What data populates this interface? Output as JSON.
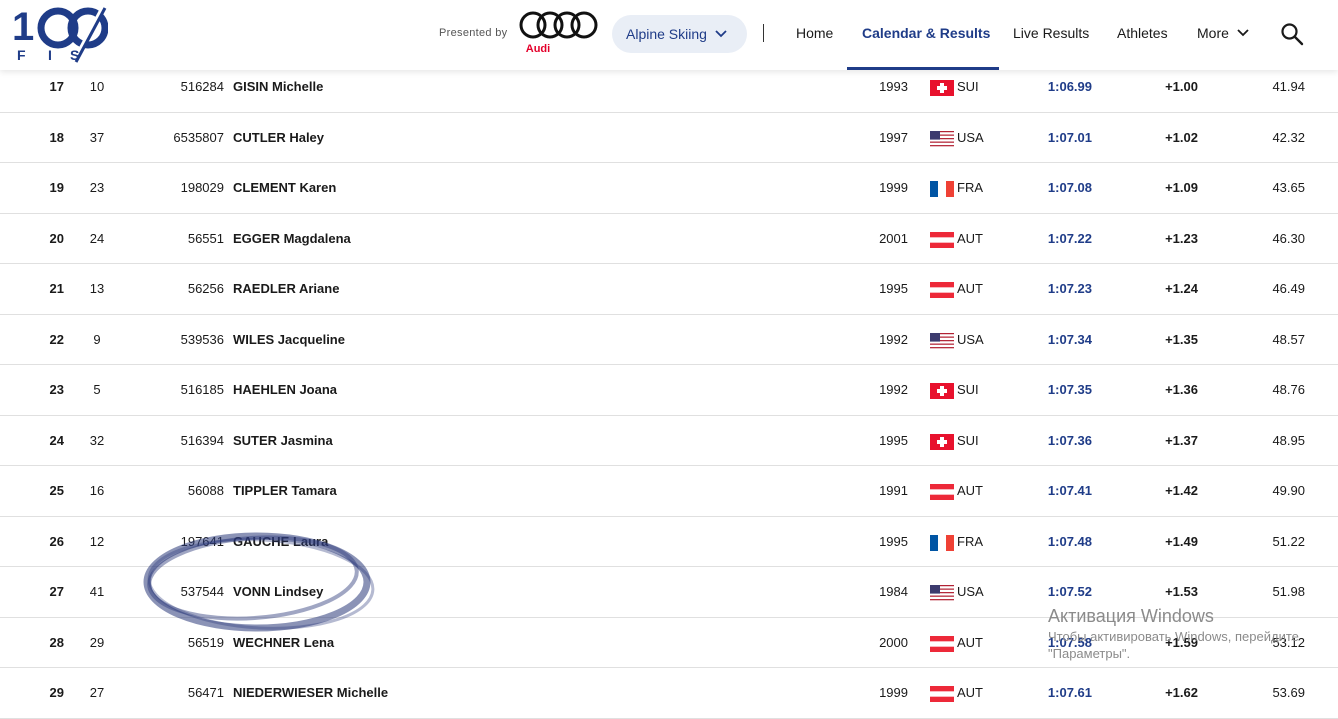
{
  "header": {
    "logo_text": "100 FIS",
    "presented_by": "Presented by",
    "sponsor": "Audi",
    "sport_selector": "Alpine Skiing",
    "nav": [
      "Home",
      "Calendar & Results",
      "Live Results",
      "Athletes",
      "More"
    ],
    "active_nav": "Calendar & Results"
  },
  "results": [
    {
      "rank": "17",
      "bib": "10",
      "fis_code": "516284",
      "name": "GISIN Michelle",
      "year": "1993",
      "nation": "SUI",
      "time": "1:06.99",
      "diff": "+1.00",
      "points": "41.94"
    },
    {
      "rank": "18",
      "bib": "37",
      "fis_code": "6535807",
      "name": "CUTLER Haley",
      "year": "1997",
      "nation": "USA",
      "time": "1:07.01",
      "diff": "+1.02",
      "points": "42.32"
    },
    {
      "rank": "19",
      "bib": "23",
      "fis_code": "198029",
      "name": "CLEMENT Karen",
      "year": "1999",
      "nation": "FRA",
      "time": "1:07.08",
      "diff": "+1.09",
      "points": "43.65"
    },
    {
      "rank": "20",
      "bib": "24",
      "fis_code": "56551",
      "name": "EGGER Magdalena",
      "year": "2001",
      "nation": "AUT",
      "time": "1:07.22",
      "diff": "+1.23",
      "points": "46.30"
    },
    {
      "rank": "21",
      "bib": "13",
      "fis_code": "56256",
      "name": "RAEDLER Ariane",
      "year": "1995",
      "nation": "AUT",
      "time": "1:07.23",
      "diff": "+1.24",
      "points": "46.49"
    },
    {
      "rank": "22",
      "bib": "9",
      "fis_code": "539536",
      "name": "WILES Jacqueline",
      "year": "1992",
      "nation": "USA",
      "time": "1:07.34",
      "diff": "+1.35",
      "points": "48.57"
    },
    {
      "rank": "23",
      "bib": "5",
      "fis_code": "516185",
      "name": "HAEHLEN Joana",
      "year": "1992",
      "nation": "SUI",
      "time": "1:07.35",
      "diff": "+1.36",
      "points": "48.76"
    },
    {
      "rank": "24",
      "bib": "32",
      "fis_code": "516394",
      "name": "SUTER Jasmina",
      "year": "1995",
      "nation": "SUI",
      "time": "1:07.36",
      "diff": "+1.37",
      "points": "48.95"
    },
    {
      "rank": "25",
      "bib": "16",
      "fis_code": "56088",
      "name": "TIPPLER Tamara",
      "year": "1991",
      "nation": "AUT",
      "time": "1:07.41",
      "diff": "+1.42",
      "points": "49.90"
    },
    {
      "rank": "26",
      "bib": "12",
      "fis_code": "197641",
      "name": "GAUCHE Laura",
      "year": "1995",
      "nation": "FRA",
      "time": "1:07.48",
      "diff": "+1.49",
      "points": "51.22"
    },
    {
      "rank": "27",
      "bib": "41",
      "fis_code": "537544",
      "name": "VONN Lindsey",
      "year": "1984",
      "nation": "USA",
      "time": "1:07.52",
      "diff": "+1.53",
      "points": "51.98"
    },
    {
      "rank": "28",
      "bib": "29",
      "fis_code": "56519",
      "name": "WECHNER Lena",
      "year": "2000",
      "nation": "AUT",
      "time": "1:07.58",
      "diff": "+1.59",
      "points": "53.12"
    },
    {
      "rank": "29",
      "bib": "27",
      "fis_code": "56471",
      "name": "NIEDERWIESER Michelle",
      "year": "1999",
      "nation": "AUT",
      "time": "1:07.61",
      "diff": "+1.62",
      "points": "53.69"
    }
  ],
  "watermark": {
    "title": "Активация Windows",
    "line1": "Чтобы активировать Windows, перейдите",
    "line2": "\"Параметры\"."
  },
  "colors": {
    "accent": "#1f3c88",
    "pill_bg": "#e9eef6",
    "audi_red": "#e4002b"
  }
}
